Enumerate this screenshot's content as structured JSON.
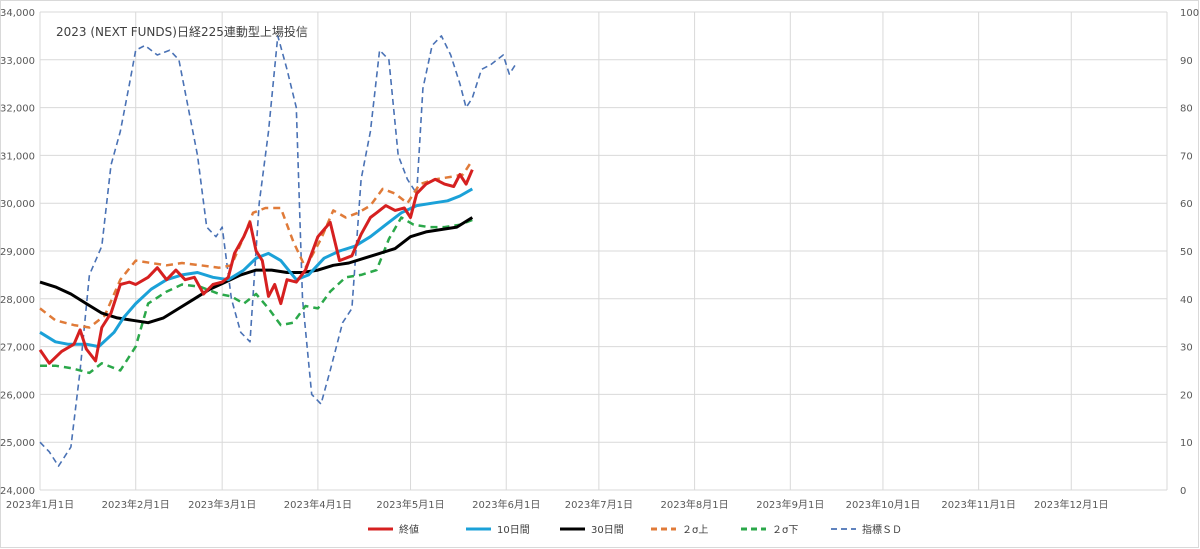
{
  "chart_data": {
    "type": "line",
    "title": "2023 (NEXT FUNDS)日経225連動型上場投信",
    "y_left": {
      "min": 24000,
      "max": 34000,
      "step": 1000
    },
    "y_right": {
      "min": 0,
      "max": 100,
      "step": 10
    },
    "x_range": [
      "2023-01-01",
      "2024-01-01"
    ],
    "grid": true,
    "legend_position": "bottom",
    "x_tick_labels": [
      {
        "date": "2023-01-01",
        "label": "2023年1月1日"
      },
      {
        "date": "2023-02-01",
        "label": "2023年2月1日"
      },
      {
        "date": "2023-03-01",
        "label": "2023年3月1日"
      },
      {
        "date": "2023-04-01",
        "label": "2023年4月1日"
      },
      {
        "date": "2023-05-01",
        "label": "2023年5月1日"
      },
      {
        "date": "2023-06-01",
        "label": "2023年6月1日"
      },
      {
        "date": "2023-07-01",
        "label": "2023年7月1日"
      },
      {
        "date": "2023-08-01",
        "label": "2023年8月1日"
      },
      {
        "date": "2023-09-01",
        "label": "2023年9月1日"
      },
      {
        "date": "2023-10-01",
        "label": "2023年10月1日"
      },
      {
        "date": "2023-11-01",
        "label": "2023年11月1日"
      },
      {
        "date": "2023-12-01",
        "label": "2023年12月1日"
      }
    ],
    "y_left_tick_labels": [
      "24,000",
      "25,000",
      "26,000",
      "27,000",
      "28,000",
      "29,000",
      "30,000",
      "31,000",
      "32,000",
      "33,000",
      "34,000"
    ],
    "y_right_tick_labels": [
      "0",
      "10",
      "20",
      "30",
      "40",
      "50",
      "60",
      "70",
      "80",
      "90",
      "100"
    ],
    "series": [
      {
        "name": "終値",
        "color": "#d62020",
        "dash": "solid",
        "width": 3,
        "axis": "left",
        "points": [
          [
            "2023-01-01",
            26930
          ],
          [
            "2023-01-04",
            26650
          ],
          [
            "2023-01-08",
            26900
          ],
          [
            "2023-01-12",
            27050
          ],
          [
            "2023-01-14",
            27350
          ],
          [
            "2023-01-16",
            26950
          ],
          [
            "2023-01-19",
            26700
          ],
          [
            "2023-01-21",
            27400
          ],
          [
            "2023-01-24",
            27700
          ],
          [
            "2023-01-27",
            28300
          ],
          [
            "2023-01-30",
            28350
          ],
          [
            "2023-02-01",
            28300
          ],
          [
            "2023-02-05",
            28450
          ],
          [
            "2023-02-08",
            28650
          ],
          [
            "2023-02-11",
            28400
          ],
          [
            "2023-02-14",
            28600
          ],
          [
            "2023-02-17",
            28400
          ],
          [
            "2023-02-20",
            28450
          ],
          [
            "2023-02-23",
            28100
          ],
          [
            "2023-02-26",
            28300
          ],
          [
            "2023-03-01",
            28350
          ],
          [
            "2023-03-03",
            28450
          ],
          [
            "2023-03-05",
            28950
          ],
          [
            "2023-03-08",
            29300
          ],
          [
            "2023-03-10",
            29600
          ],
          [
            "2023-03-12",
            29000
          ],
          [
            "2023-03-14",
            28800
          ],
          [
            "2023-03-16",
            28050
          ],
          [
            "2023-03-18",
            28300
          ],
          [
            "2023-03-20",
            27900
          ],
          [
            "2023-03-22",
            28400
          ],
          [
            "2023-03-25",
            28350
          ],
          [
            "2023-03-28",
            28600
          ],
          [
            "2023-04-01",
            29300
          ],
          [
            "2023-04-03",
            29450
          ],
          [
            "2023-04-05",
            29600
          ],
          [
            "2023-04-08",
            28800
          ],
          [
            "2023-04-12",
            28900
          ],
          [
            "2023-04-15",
            29350
          ],
          [
            "2023-04-18",
            29700
          ],
          [
            "2023-04-20",
            29800
          ],
          [
            "2023-04-23",
            29950
          ],
          [
            "2023-04-26",
            29850
          ],
          [
            "2023-04-29",
            29900
          ],
          [
            "2023-05-01",
            29700
          ],
          [
            "2023-05-03",
            30200
          ],
          [
            "2023-05-06",
            30400
          ],
          [
            "2023-05-09",
            30500
          ],
          [
            "2023-05-12",
            30400
          ],
          [
            "2023-05-15",
            30350
          ],
          [
            "2023-05-17",
            30600
          ],
          [
            "2023-05-19",
            30400
          ],
          [
            "2023-05-21",
            30700
          ]
        ]
      },
      {
        "name": "10日間",
        "color": "#1ba1d8",
        "dash": "solid",
        "width": 3,
        "axis": "left",
        "points": [
          [
            "2023-01-01",
            27300
          ],
          [
            "2023-01-06",
            27100
          ],
          [
            "2023-01-10",
            27050
          ],
          [
            "2023-01-16",
            27050
          ],
          [
            "2023-01-20",
            27000
          ],
          [
            "2023-01-25",
            27300
          ],
          [
            "2023-01-28",
            27600
          ],
          [
            "2023-02-01",
            27900
          ],
          [
            "2023-02-06",
            28200
          ],
          [
            "2023-02-11",
            28400
          ],
          [
            "2023-02-16",
            28500
          ],
          [
            "2023-02-21",
            28550
          ],
          [
            "2023-02-26",
            28450
          ],
          [
            "2023-03-03",
            28400
          ],
          [
            "2023-03-08",
            28600
          ],
          [
            "2023-03-12",
            28850
          ],
          [
            "2023-03-16",
            28950
          ],
          [
            "2023-03-20",
            28800
          ],
          [
            "2023-03-25",
            28400
          ],
          [
            "2023-03-29",
            28500
          ],
          [
            "2023-04-03",
            28850
          ],
          [
            "2023-04-08",
            29000
          ],
          [
            "2023-04-13",
            29100
          ],
          [
            "2023-04-18",
            29300
          ],
          [
            "2023-04-23",
            29550
          ],
          [
            "2023-04-28",
            29800
          ],
          [
            "2023-05-03",
            29950
          ],
          [
            "2023-05-08",
            30000
          ],
          [
            "2023-05-13",
            30050
          ],
          [
            "2023-05-17",
            30150
          ],
          [
            "2023-05-21",
            30300
          ]
        ]
      },
      {
        "name": "30日間",
        "color": "#000000",
        "dash": "solid",
        "width": 3,
        "axis": "left",
        "points": [
          [
            "2023-01-01",
            28350
          ],
          [
            "2023-01-06",
            28250
          ],
          [
            "2023-01-11",
            28100
          ],
          [
            "2023-01-16",
            27900
          ],
          [
            "2023-01-21",
            27700
          ],
          [
            "2023-01-26",
            27600
          ],
          [
            "2023-01-31",
            27550
          ],
          [
            "2023-02-05",
            27500
          ],
          [
            "2023-02-10",
            27600
          ],
          [
            "2023-02-15",
            27800
          ],
          [
            "2023-02-20",
            28000
          ],
          [
            "2023-02-25",
            28200
          ],
          [
            "2023-03-02",
            28350
          ],
          [
            "2023-03-07",
            28500
          ],
          [
            "2023-03-12",
            28600
          ],
          [
            "2023-03-17",
            28600
          ],
          [
            "2023-03-22",
            28550
          ],
          [
            "2023-03-27",
            28550
          ],
          [
            "2023-04-01",
            28600
          ],
          [
            "2023-04-06",
            28700
          ],
          [
            "2023-04-11",
            28750
          ],
          [
            "2023-04-16",
            28850
          ],
          [
            "2023-04-21",
            28950
          ],
          [
            "2023-04-26",
            29050
          ],
          [
            "2023-05-01",
            29300
          ],
          [
            "2023-05-06",
            29400
          ],
          [
            "2023-05-11",
            29450
          ],
          [
            "2023-05-16",
            29500
          ],
          [
            "2023-05-21",
            29700
          ]
        ]
      },
      {
        "name": "２σ上",
        "color": "#e07b39",
        "dash": "dashed",
        "width": 2.5,
        "axis": "left",
        "points": [
          [
            "2023-01-01",
            27800
          ],
          [
            "2023-01-06",
            27550
          ],
          [
            "2023-01-12",
            27450
          ],
          [
            "2023-01-17",
            27400
          ],
          [
            "2023-01-22",
            27650
          ],
          [
            "2023-01-27",
            28400
          ],
          [
            "2023-02-01",
            28800
          ],
          [
            "2023-02-06",
            28750
          ],
          [
            "2023-02-11",
            28700
          ],
          [
            "2023-02-16",
            28750
          ],
          [
            "2023-02-22",
            28700
          ],
          [
            "2023-02-28",
            28650
          ],
          [
            "2023-03-04",
            28700
          ],
          [
            "2023-03-08",
            29300
          ],
          [
            "2023-03-11",
            29800
          ],
          [
            "2023-03-15",
            29900
          ],
          [
            "2023-03-20",
            29900
          ],
          [
            "2023-03-24",
            29200
          ],
          [
            "2023-03-28",
            28650
          ],
          [
            "2023-04-02",
            29250
          ],
          [
            "2023-04-06",
            29850
          ],
          [
            "2023-04-10",
            29700
          ],
          [
            "2023-04-14",
            29800
          ],
          [
            "2023-04-18",
            29950
          ],
          [
            "2023-04-22",
            30300
          ],
          [
            "2023-04-26",
            30200
          ],
          [
            "2023-04-30",
            30000
          ],
          [
            "2023-05-04",
            30400
          ],
          [
            "2023-05-09",
            30500
          ],
          [
            "2023-05-14",
            30550
          ],
          [
            "2023-05-18",
            30600
          ],
          [
            "2023-05-21",
            30900
          ]
        ]
      },
      {
        "name": "２σ下",
        "color": "#2ba84a",
        "dash": "dashed",
        "width": 2.5,
        "axis": "left",
        "points": [
          [
            "2023-01-01",
            26600
          ],
          [
            "2023-01-06",
            26600
          ],
          [
            "2023-01-11",
            26550
          ],
          [
            "2023-01-17",
            26450
          ],
          [
            "2023-01-21",
            26650
          ],
          [
            "2023-01-27",
            26500
          ],
          [
            "2023-02-01",
            27000
          ],
          [
            "2023-02-05",
            27900
          ],
          [
            "2023-02-11",
            28150
          ],
          [
            "2023-02-16",
            28300
          ],
          [
            "2023-02-22",
            28250
          ],
          [
            "2023-02-28",
            28100
          ],
          [
            "2023-03-04",
            28050
          ],
          [
            "2023-03-08",
            27900
          ],
          [
            "2023-03-12",
            28100
          ],
          [
            "2023-03-16",
            27800
          ],
          [
            "2023-03-20",
            27450
          ],
          [
            "2023-03-24",
            27500
          ],
          [
            "2023-03-28",
            27850
          ],
          [
            "2023-04-01",
            27800
          ],
          [
            "2023-04-05",
            28150
          ],
          [
            "2023-04-10",
            28450
          ],
          [
            "2023-04-15",
            28500
          ],
          [
            "2023-04-20",
            28600
          ],
          [
            "2023-04-24",
            29250
          ],
          [
            "2023-04-28",
            29700
          ],
          [
            "2023-05-02",
            29550
          ],
          [
            "2023-05-07",
            29500
          ],
          [
            "2023-05-12",
            29500
          ],
          [
            "2023-05-17",
            29550
          ],
          [
            "2023-05-21",
            29650
          ]
        ]
      },
      {
        "name": "指標ＳＤ",
        "color": "#4a72b5",
        "dash": "dashed",
        "width": 1.6,
        "axis": "right",
        "points": [
          [
            "2023-01-01",
            10
          ],
          [
            "2023-01-04",
            8
          ],
          [
            "2023-01-07",
            5
          ],
          [
            "2023-01-11",
            9
          ],
          [
            "2023-01-14",
            25
          ],
          [
            "2023-01-17",
            45
          ],
          [
            "2023-01-21",
            51
          ],
          [
            "2023-01-24",
            68
          ],
          [
            "2023-01-27",
            75
          ],
          [
            "2023-01-30",
            85
          ],
          [
            "2023-02-01",
            92
          ],
          [
            "2023-02-04",
            93
          ],
          [
            "2023-02-08",
            91
          ],
          [
            "2023-02-12",
            92
          ],
          [
            "2023-02-15",
            90
          ],
          [
            "2023-02-18",
            80
          ],
          [
            "2023-02-21",
            70
          ],
          [
            "2023-02-24",
            55
          ],
          [
            "2023-02-27",
            53
          ],
          [
            "2023-03-01",
            55
          ],
          [
            "2023-03-04",
            40
          ],
          [
            "2023-03-07",
            33
          ],
          [
            "2023-03-10",
            31
          ],
          [
            "2023-03-13",
            60
          ],
          [
            "2023-03-16",
            75
          ],
          [
            "2023-03-19",
            95
          ],
          [
            "2023-03-22",
            88
          ],
          [
            "2023-03-25",
            80
          ],
          [
            "2023-03-27",
            40
          ],
          [
            "2023-03-30",
            20
          ],
          [
            "2023-04-02",
            18
          ],
          [
            "2023-04-05",
            25
          ],
          [
            "2023-04-09",
            35
          ],
          [
            "2023-04-12",
            38
          ],
          [
            "2023-04-15",
            65
          ],
          [
            "2023-04-18",
            75
          ],
          [
            "2023-04-21",
            92
          ],
          [
            "2023-04-24",
            90
          ],
          [
            "2023-04-27",
            70
          ],
          [
            "2023-04-30",
            65
          ],
          [
            "2023-05-03",
            62
          ],
          [
            "2023-05-05",
            84
          ],
          [
            "2023-05-08",
            93
          ],
          [
            "2023-05-11",
            95
          ],
          [
            "2023-05-14",
            91
          ],
          [
            "2023-05-17",
            85
          ],
          [
            "2023-05-19",
            80
          ],
          [
            "2023-05-21",
            82
          ],
          [
            "2023-05-24",
            88
          ],
          [
            "2023-05-27",
            89
          ],
          [
            "2023-05-31",
            91
          ],
          [
            "2023-06-02",
            87
          ],
          [
            "2023-06-04",
            89
          ]
        ]
      }
    ]
  }
}
